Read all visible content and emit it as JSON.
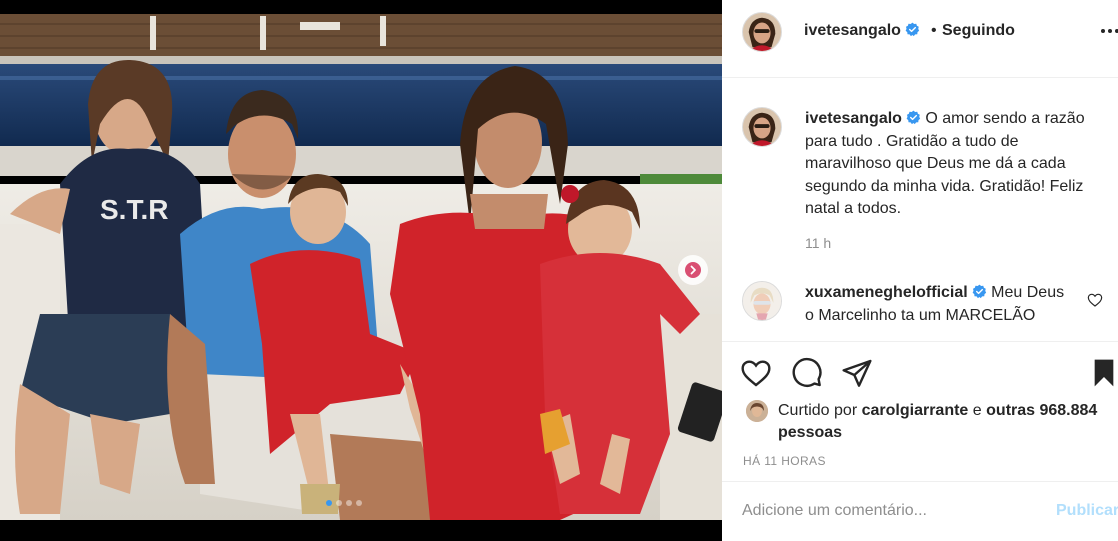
{
  "post": {
    "author": "ivetesangalo",
    "follow_status": "Seguindo",
    "separator": "•"
  },
  "carousel": {
    "total_slides": 4,
    "active_slide": 1
  },
  "caption": {
    "user": "ivetesangalo",
    "text": "O amor sendo a razão para tudo . Gratidão a tudo de maravilhoso que Deus me dá a cada segundo da minha vida. Gratidão! Feliz natal a todos.",
    "time": "11 h"
  },
  "comments": [
    {
      "user": "xuxameneghelooficial",
      "user_display": "xuxameneghelofficial",
      "text": "Meu Deus o Marcelinho ta um MARCELÃO"
    }
  ],
  "likes": {
    "prefix": "Curtido por",
    "user": "carolgiarrante",
    "connector": "e",
    "others": "outras 968.884 pessoas"
  },
  "timestamp": "HÁ 11 HORAS",
  "add_comment": {
    "placeholder": "Adicione um comentário...",
    "publish_label": "Publicar"
  },
  "colors": {
    "verified": "#3897f0",
    "publish_disabled": "#b2dffc",
    "muted": "#8e8e8e",
    "dress_red": "#d0232a"
  },
  "icons": [
    "verified-badge-icon",
    "more-options-icon",
    "like-heart-icon",
    "comment-bubble-icon",
    "share-plane-icon",
    "bookmark-icon",
    "chevron-right-icon"
  ]
}
